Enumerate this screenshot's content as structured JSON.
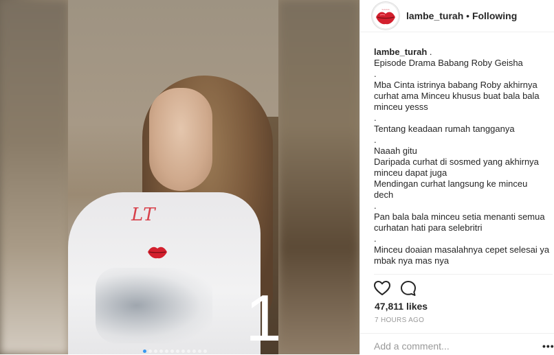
{
  "post": {
    "username": "lambe_turah",
    "separator": " • ",
    "follow_status": "Following",
    "video_overlay": {
      "watermark_script": "LT",
      "counter": "1"
    },
    "caption": {
      "username": "lambe_turah",
      "lines": [
        " .",
        "Episode Drama Babang Roby Geisha",
        ".",
        "Mba Cinta istrinya babang Roby akhirnya",
        "curhat ama Minceu khusus buat bala bala",
        "minceu yesss",
        ".",
        "Tentang keadaan rumah tangganya",
        ".",
        "Naaah gitu",
        "Daripada curhat di sosmed yang akhirnya",
        "minceu dapat juga",
        "Mendingan curhat langsung ke minceu",
        "dech",
        ".",
        "Pan bala bala minceu setia menanti semua",
        "curhatan hati para selebritri",
        ".",
        "Minceu doaian masalahnya cepet selesai ya",
        "mbak nya mas nya"
      ]
    },
    "likes": "47,811 likes",
    "timestamp": "7 HOURS AGO",
    "comment_placeholder": "Add a comment...",
    "more_label": "•••",
    "carousel": {
      "count": 12,
      "active_index": 0
    },
    "icons": {
      "like": "heart-icon",
      "comment": "comment-bubble-icon",
      "avatar": "lips-logo"
    },
    "colors": {
      "accent": "#3897f0",
      "text": "#262626",
      "muted": "#999999",
      "lips": "#d3202e"
    }
  }
}
